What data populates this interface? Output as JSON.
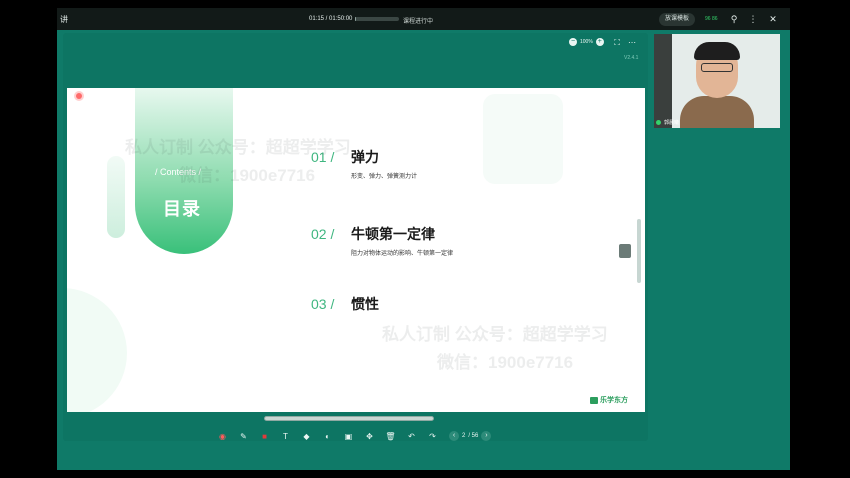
{
  "topbar": {
    "brand": "讲",
    "elapsed": "01:15",
    "total": "01:50:00",
    "progress_fraction": 0.02,
    "status": "课程进行中",
    "pill_label": "放课模板",
    "network": "96 86",
    "icons": [
      "zoom-icon",
      "more-icon",
      "close-icon"
    ]
  },
  "slide_toolbar": {
    "zoom_level": "100%",
    "version": "V2.4.1",
    "icons": [
      "zoom-out-icon",
      "zoom-in-icon",
      "fullscreen-icon",
      "more-icon"
    ]
  },
  "slide": {
    "contents_label": "/ Contents /",
    "toc_title": "目录",
    "items": [
      {
        "num": "01 /",
        "title": "弹力",
        "sub": "形变、弹力、弹簧测力计"
      },
      {
        "num": "02 /",
        "title": "牛顿第一定律",
        "sub": "阻力对物体运动的影响、牛顿第一定律"
      },
      {
        "num": "03 /",
        "title": "惯性",
        "sub": ""
      }
    ],
    "logo": "乐学东方",
    "watermark_1": "私人订制 公众号：超超学学习",
    "watermark_2": "微信：1900e7716",
    "watermark_3": "私人订制 公众号：超超学学习",
    "watermark_4": "微信：1900e7716"
  },
  "bottom_toolbar": {
    "tools": [
      "record-icon",
      "pen-icon",
      "color-red-icon",
      "text-icon",
      "tag-icon",
      "eraser-icon",
      "screen-icon",
      "move-icon",
      "delete-icon",
      "undo-icon",
      "redo-icon"
    ],
    "page_current": "2",
    "page_total": "/ 56"
  },
  "video": {
    "name": "郭晨曦"
  },
  "colors": {
    "accent": "#0f7a68",
    "green": "#3fb680",
    "logo_green": "#2c9e5e"
  }
}
